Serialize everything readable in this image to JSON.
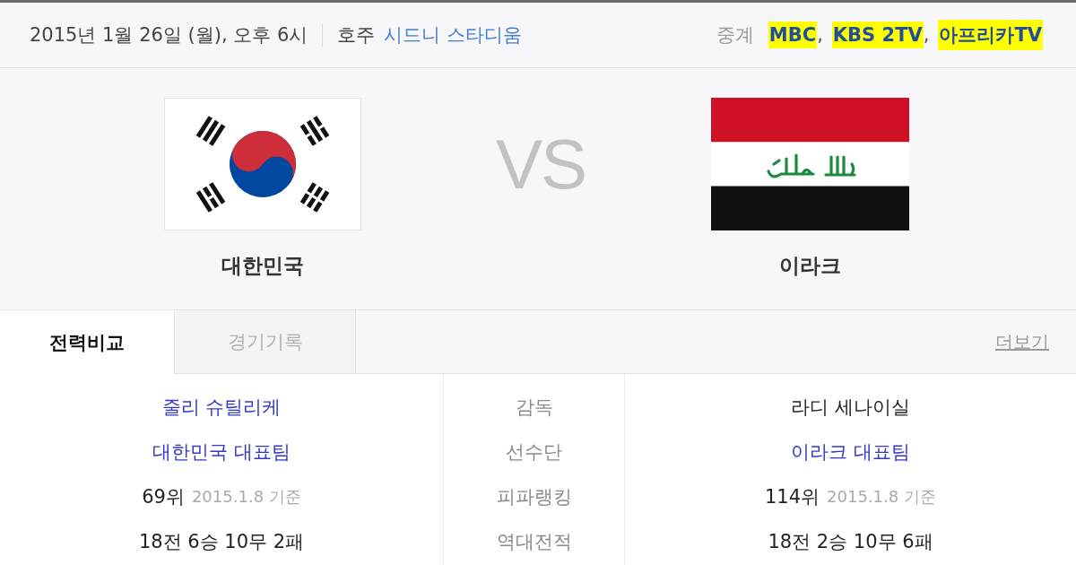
{
  "match_info": {
    "datetime": "2015년 1월 26일 (월), 오후 6시",
    "country": "호주",
    "venue": "시드니 스타디움",
    "broadcast_label": "중계",
    "broadcasters": [
      {
        "name": "MBC",
        "separator": ",",
        "highlighted": true
      },
      {
        "name": "KBS 2TV",
        "separator": ",",
        "highlighted": true
      },
      {
        "name": "아프리카TV",
        "highlighted": true
      }
    ]
  },
  "teams": [
    {
      "name": "대한민국",
      "kind": "korea"
    },
    {
      "name": "이라크",
      "kind": "iraq"
    }
  ],
  "vs": "VS",
  "tabs": [
    {
      "label": "전력비교",
      "selected": true
    },
    {
      "label": "경기기록",
      "selected": false
    }
  ],
  "more_link": "더보기",
  "comparison": [
    {
      "label": "감독",
      "home": {
        "text": "줄리 슈틸리케",
        "kind": "link"
      },
      "away": {
        "text": "라디 세나이실",
        "kind": "text"
      }
    },
    {
      "label": "선수단",
      "home": {
        "text": "대한민국 대표팀",
        "kind": "link"
      },
      "away": {
        "text": "이라크 대표팀",
        "kind": "link"
      }
    },
    {
      "label": "피파랭킹",
      "home": {
        "text": "69위",
        "kind": "text",
        "note": "2015.1.8 기준"
      },
      "away": {
        "text": "114위",
        "kind": "text",
        "note": "2015.1.8 기준"
      }
    },
    {
      "label": "역대전적",
      "home": {
        "text": "18전 6승 10무 2패",
        "kind": "text"
      },
      "away": {
        "text": "18전 2승 10무 6패",
        "kind": "text"
      }
    }
  ]
}
